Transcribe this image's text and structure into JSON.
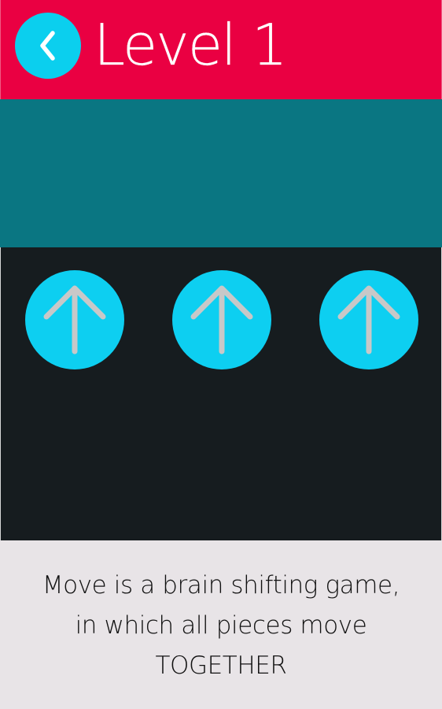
{
  "header": {
    "title": "Level 1",
    "back_icon": "chevron-left-icon",
    "background_color": "#ea0042",
    "back_button_color": "#0bcfee"
  },
  "game": {
    "target_zone_color": "#0a7682",
    "board_color": "#161c1f",
    "pieces": [
      {
        "direction": "up",
        "icon": "arrow-up-icon"
      },
      {
        "direction": "up",
        "icon": "arrow-up-icon"
      },
      {
        "direction": "up",
        "icon": "arrow-up-icon"
      }
    ],
    "piece_color": "#0dcff1",
    "arrow_color": "#c8c8c8"
  },
  "description": {
    "text": "Move is a  brain shifting game, in which all pieces move TOGETHER"
  }
}
